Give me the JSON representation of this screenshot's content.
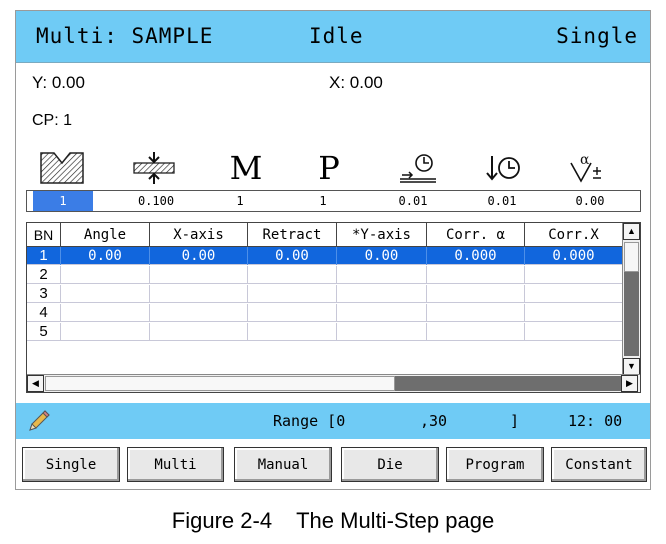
{
  "header": {
    "title": "Multi: SAMPLE",
    "status": "Idle",
    "mode": "Single"
  },
  "coords": {
    "y": "Y: 0.00",
    "x": "X: 0.00",
    "cp": "CP: 1"
  },
  "params": {
    "icons": [
      "die-icon",
      "crowning-icon",
      "m-icon",
      "p-icon",
      "dwell-time-icon",
      "hold-time-icon",
      "angle-correction-icon"
    ],
    "letters": {
      "m": "M",
      "p": "P"
    },
    "values": [
      "1",
      "0.100",
      "1",
      "1",
      "0.01",
      "0.01",
      "0.00"
    ]
  },
  "table": {
    "headers": [
      "BN",
      "Angle",
      "X-axis",
      "Retract",
      "*Y-axis",
      "Corr. α",
      "Corr.X"
    ],
    "rows": [
      [
        "1",
        "0.00",
        "0.00",
        "0.00",
        "0.00",
        "0.000",
        "0.000"
      ],
      [
        "2",
        "",
        "",
        "",
        "",
        "",
        ""
      ],
      [
        "3",
        "",
        "",
        "",
        "",
        "",
        ""
      ],
      [
        "4",
        "",
        "",
        "",
        "",
        "",
        ""
      ],
      [
        "5",
        "",
        "",
        "",
        "",
        "",
        ""
      ]
    ],
    "selected_row": 1
  },
  "status": {
    "icon": "pencil-icon",
    "range_label": "Range [0",
    "range_sep": ",30",
    "range_end": "]",
    "time": "12: 00"
  },
  "buttons": [
    "Single",
    "Multi",
    "Manual",
    "Die",
    "Program",
    "Constant"
  ],
  "caption": "Figure 2-4    The Multi-Step page",
  "colors": {
    "header_bg": "#6fcbf5",
    "selection": "#1166dd",
    "active_value": "#3b7de6"
  }
}
